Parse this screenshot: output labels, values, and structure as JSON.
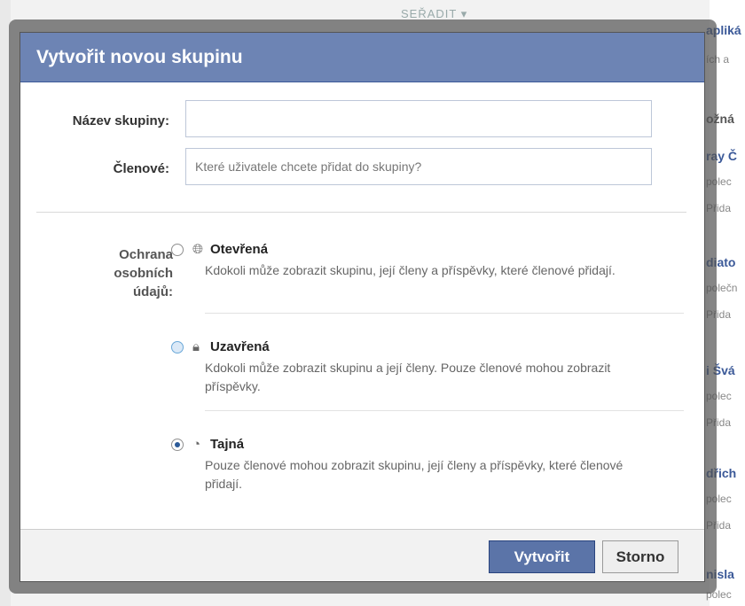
{
  "background": {
    "sort_label": "SEŘADIT ▾",
    "right_fragments": [
      "apliká",
      "ích a",
      "ožná",
      "ray Č",
      "polec",
      "Přida",
      "diato",
      "polečn",
      "Přida",
      "i Švá",
      "polec",
      "Přida",
      "dřich",
      "polec",
      "Přida",
      "nisla",
      "polec"
    ]
  },
  "dialog": {
    "title": "Vytvořit novou skupinu",
    "name_label": "Název skupiny:",
    "name_value": "",
    "members_label": "Členové:",
    "members_placeholder": "Které uživatele chcete přidat do skupiny?",
    "privacy_label": "Ochrana osobních údajů:",
    "options": [
      {
        "title": "Otevřená",
        "icon": "globe-icon",
        "description": "Kdokoli může zobrazit skupinu, její členy a příspěvky, které členové přidají.",
        "selected": false
      },
      {
        "title": "Uzavřená",
        "icon": "lock-icon",
        "description": "Kdokoli může zobrazit skupinu a její členy. Pouze členové mohou zobrazit příspěvky.",
        "selected": false
      },
      {
        "title": "Tajná",
        "icon": "secret-icon",
        "description": "Pouze členové mohou zobrazit skupinu, její členy a příspěvky, které členové přidají.",
        "selected": true
      }
    ],
    "create_label": "Vytvořit",
    "cancel_label": "Storno"
  },
  "colors": {
    "header": "#6d84b4",
    "primary_button": "#5b74a8",
    "link": "#3b5998"
  }
}
